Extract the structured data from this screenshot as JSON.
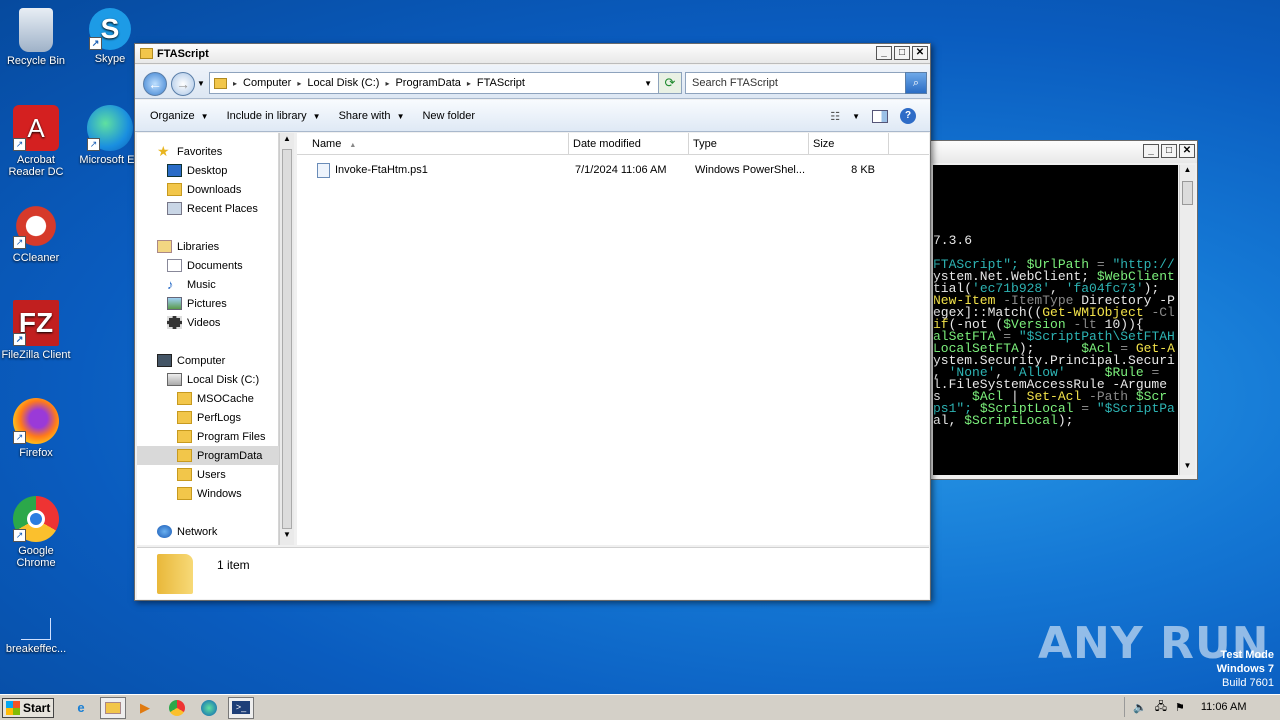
{
  "desktop": {
    "icons": [
      {
        "label": "Recycle Bin",
        "x": 0
      },
      {
        "label": "Skype"
      },
      {
        "label": "Acrobat Reader DC"
      },
      {
        "label": "Microsoft Edge"
      },
      {
        "label": "CCleaner"
      },
      {
        "label": "FileZilla Client"
      },
      {
        "label": "Firefox"
      },
      {
        "label": "Google Chrome"
      },
      {
        "label": "breakeffec..."
      }
    ]
  },
  "explorer": {
    "title": "FTAScript",
    "breadcrumb": [
      "Computer",
      "Local Disk (C:)",
      "ProgramData",
      "FTAScript"
    ],
    "search_placeholder": "Search FTAScript",
    "commands": {
      "organize": "Organize",
      "include": "Include in library",
      "share": "Share with",
      "newfolder": "New folder"
    },
    "nav": {
      "favorites": "Favorites",
      "desktop": "Desktop",
      "downloads": "Downloads",
      "recent": "Recent Places",
      "libraries": "Libraries",
      "documents": "Documents",
      "music": "Music",
      "pictures": "Pictures",
      "videos": "Videos",
      "computer": "Computer",
      "localdisk": "Local Disk (C:)",
      "msocache": "MSOCache",
      "perflogs": "PerfLogs",
      "programfiles": "Program Files",
      "programdata": "ProgramData",
      "users": "Users",
      "windows": "Windows",
      "network": "Network"
    },
    "columns": {
      "name": "Name",
      "date": "Date modified",
      "type": "Type",
      "size": "Size"
    },
    "files": [
      {
        "name": "Invoke-FtaHtm.ps1",
        "date": "7/1/2024 11:06 AM",
        "type": "Windows PowerShel...",
        "size": "8 KB"
      }
    ],
    "status": "1 item"
  },
  "powershell": {
    "lines": [
      [
        {
          "t": "7.3.6",
          "c": "w"
        }
      ],
      [],
      [
        {
          "t": "FTAScript\"; ",
          "c": "c"
        },
        {
          "t": "$UrlPath",
          "c": "g"
        },
        {
          "t": " = ",
          "c": "gr"
        },
        {
          "t": "\"http://",
          "c": "c"
        }
      ],
      [
        {
          "t": "ystem.Net.WebClient; ",
          "c": "w"
        },
        {
          "t": "$WebClient",
          "c": "g"
        }
      ],
      [
        {
          "t": "tial(",
          "c": "w"
        },
        {
          "t": "'ec71b928'",
          "c": "c"
        },
        {
          "t": ", ",
          "c": "w"
        },
        {
          "t": "'fa04fc73'",
          "c": "c"
        },
        {
          "t": ");",
          "c": "w"
        }
      ],
      [
        {
          "t": "New-Item",
          "c": "y"
        },
        {
          "t": " -ItemType ",
          "c": "gr"
        },
        {
          "t": "Directory -P",
          "c": "w"
        }
      ],
      [
        {
          "t": "egex]::Match((",
          "c": "w"
        },
        {
          "t": "Get-WMIObject",
          "c": "y"
        },
        {
          "t": " -Cl",
          "c": "gr"
        }
      ],
      [
        {
          "t": "if",
          "c": "y"
        },
        {
          "t": "(-not (",
          "c": "w"
        },
        {
          "t": "$Version",
          "c": "g"
        },
        {
          "t": " -lt ",
          "c": "gr"
        },
        {
          "t": "10",
          "c": "w"
        },
        {
          "t": ")){",
          "c": "w"
        }
      ],
      [
        {
          "t": "alSetFTA",
          "c": "g"
        },
        {
          "t": " = ",
          "c": "gr"
        },
        {
          "t": "\"$ScriptPath",
          "c": "c"
        },
        {
          "t": "\\SetFTAH",
          "c": "c"
        }
      ],
      [
        {
          "t": "LocalSetFTA",
          "c": "g"
        },
        {
          "t": ");      ",
          "c": "w"
        },
        {
          "t": "$Acl",
          "c": "g"
        },
        {
          "t": " = ",
          "c": "gr"
        },
        {
          "t": "Get-A",
          "c": "y"
        }
      ],
      [
        {
          "t": "ystem.Security.Principal.Securi",
          "c": "w"
        }
      ],
      [
        {
          "t": ", ",
          "c": "w"
        },
        {
          "t": "'None'",
          "c": "c"
        },
        {
          "t": ", ",
          "c": "w"
        },
        {
          "t": "'Allow'",
          "c": "c"
        },
        {
          "t": "     ",
          "c": "w"
        },
        {
          "t": "$Rule",
          "c": "g"
        },
        {
          "t": " =",
          "c": "gr"
        }
      ],
      [
        {
          "t": "l.FileSystemAccessRule -Argume",
          "c": "w"
        }
      ],
      [
        {
          "t": "s    ",
          "c": "w"
        },
        {
          "t": "$Acl",
          "c": "g"
        },
        {
          "t": " | ",
          "c": "w"
        },
        {
          "t": "Set-Acl",
          "c": "y"
        },
        {
          "t": " -Path ",
          "c": "gr"
        },
        {
          "t": "$Scr",
          "c": "g"
        }
      ],
      [
        {
          "t": "ps1\"; ",
          "c": "c"
        },
        {
          "t": "$ScriptLocal",
          "c": "g"
        },
        {
          "t": " = ",
          "c": "gr"
        },
        {
          "t": "\"$ScriptPa",
          "c": "c"
        }
      ],
      [
        {
          "t": "al, ",
          "c": "w"
        },
        {
          "t": "$ScriptLocal",
          "c": "g"
        },
        {
          "t": ");",
          "c": "w"
        }
      ]
    ]
  },
  "taskbar": {
    "start": "Start",
    "clock": "11:06 AM"
  },
  "watermark": {
    "line1": "Test Mode",
    "line2": "Windows 7",
    "line3": "Build 7601",
    "brand": "ANY RUN"
  }
}
